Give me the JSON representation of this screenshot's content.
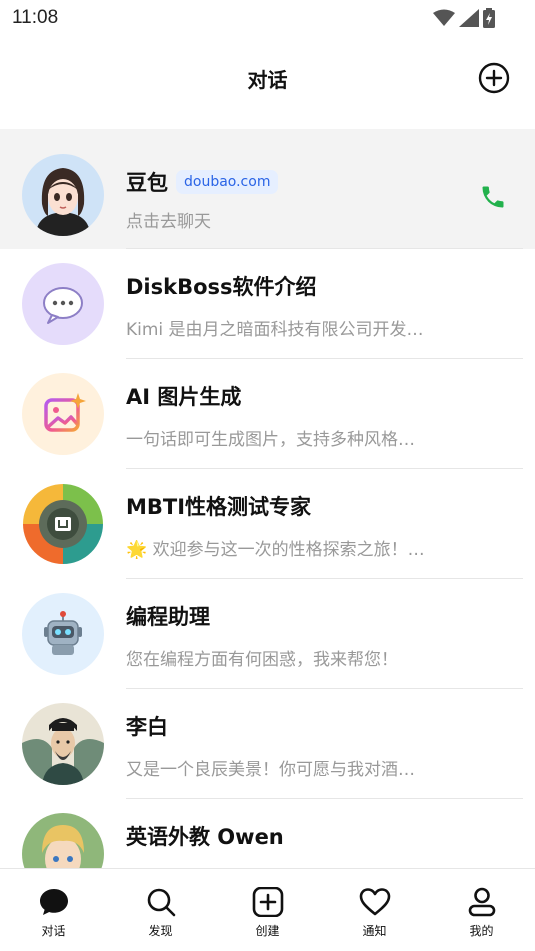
{
  "status": {
    "time": "11:08"
  },
  "header": {
    "title": "对话",
    "new_chat_icon": "plus-circle-icon"
  },
  "chats": [
    {
      "title": "豆包",
      "badge": "doubao.com",
      "subtitle": "点击去聊天",
      "avatar": "doubao-avatar",
      "action_icon": "phone-icon",
      "action_color": "#22b14c"
    },
    {
      "title": "DiskBoss软件介绍",
      "subtitle": "Kimi 是由月之暗面科技有限公司开发…",
      "avatar": "chat-bubble-avatar"
    },
    {
      "title": "AI 图片生成",
      "subtitle": "一句话即可生成图片，支持多种风格…",
      "avatar": "image-sparkle-avatar"
    },
    {
      "title": "MBTI性格测试专家",
      "subtitle": "🌟 欢迎参与这一次的性格探索之旅！…",
      "avatar": "mbti-wheel-avatar"
    },
    {
      "title": "编程助理",
      "subtitle": "您在编程方面有何困惑，我来帮您！",
      "avatar": "robot-avatar"
    },
    {
      "title": "李白",
      "subtitle": "又是一个良辰美景！你可愿与我对酒…",
      "avatar": "li-bai-avatar"
    },
    {
      "title": "英语外教 Owen",
      "subtitle": "",
      "avatar": "owen-avatar"
    }
  ],
  "tabs": [
    {
      "label": "对话",
      "icon": "chat-bubble-icon",
      "active": true
    },
    {
      "label": "发现",
      "icon": "search-icon"
    },
    {
      "label": "创建",
      "icon": "plus-square-icon"
    },
    {
      "label": "通知",
      "icon": "heart-icon"
    },
    {
      "label": "我的",
      "icon": "person-icon"
    }
  ],
  "colors": {
    "highlight": "#f3f3f3",
    "badge_text": "#2a64e6",
    "badge_bg": "#e6efff",
    "call_green": "#22b14c"
  }
}
